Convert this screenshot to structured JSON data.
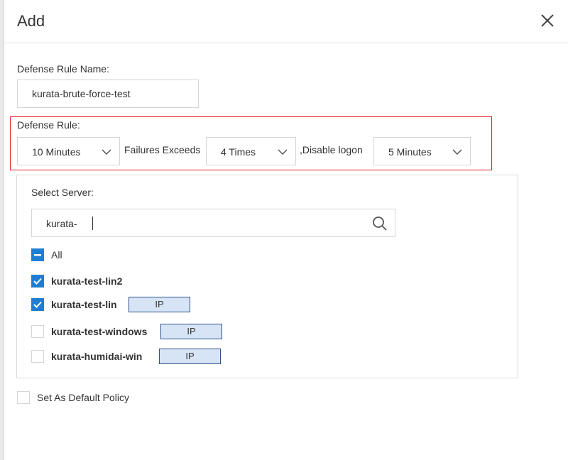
{
  "dialog": {
    "title": "Add",
    "close_icon": "close-icon"
  },
  "rule_name": {
    "label": "Defense Rule Name:",
    "value": "kurata-brute-force-test"
  },
  "defense_rule": {
    "label": "Defense Rule:",
    "period": "10 Minutes",
    "failures_text": "Failures Exceeds",
    "times": "4 Times",
    "disable_text": ",Disable logon",
    "duration": "5 Minutes",
    "highlight_color": "#e0202a"
  },
  "server_select": {
    "label": "Select Server:",
    "search_value": "kurata-",
    "search_icon": "search-icon",
    "all_label": "All",
    "servers": [
      {
        "name": "kurata-test-lin2",
        "checked": true,
        "ip": ""
      },
      {
        "name": "kurata-test-lin",
        "checked": true,
        "ip": "IP"
      },
      {
        "name": "kurata-test-windows",
        "checked": false,
        "ip": "IP"
      },
      {
        "name": "kurata-humidai-win",
        "checked": false,
        "ip": "IP"
      }
    ]
  },
  "default_policy": {
    "label": "Set As Default Policy",
    "checked": false
  },
  "colors": {
    "accent": "#1f7ed3",
    "ip_badge_bg": "#d6e4f5",
    "ip_badge_border": "#2f4f90"
  }
}
